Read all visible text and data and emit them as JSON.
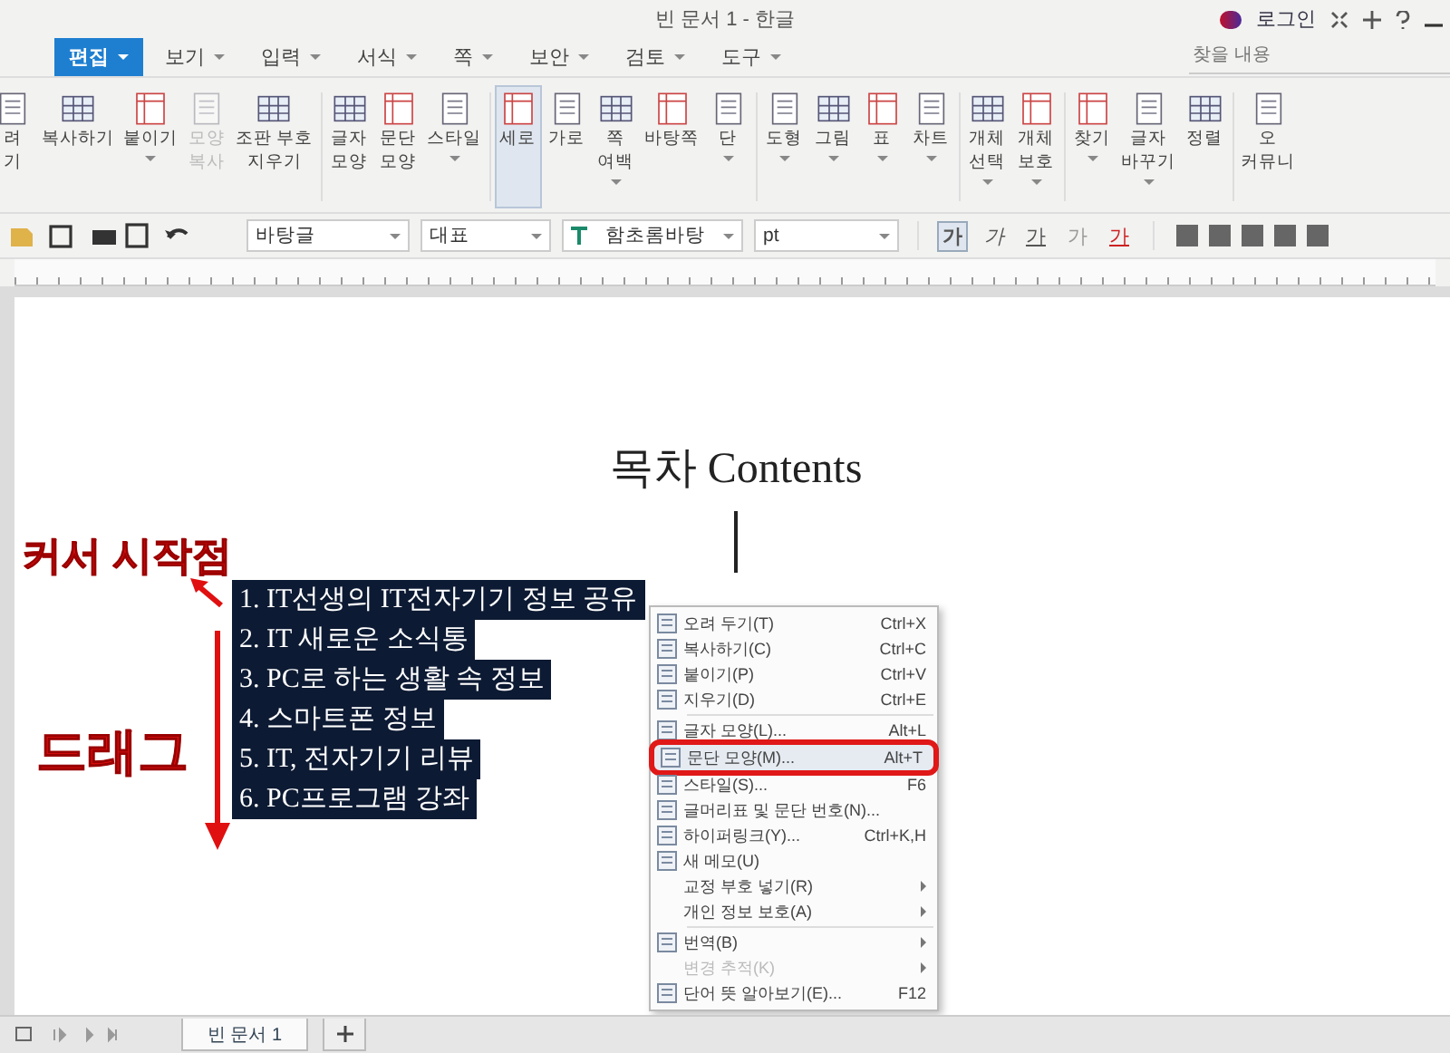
{
  "window": {
    "title": "빈 문서 1 - 한글",
    "login": "로그인"
  },
  "menu": [
    {
      "label": "편집",
      "selected": true
    },
    {
      "label": "보기",
      "selected": false
    },
    {
      "label": "입력",
      "selected": false
    },
    {
      "label": "서식",
      "selected": false
    },
    {
      "label": "쪽",
      "selected": false
    },
    {
      "label": "보안",
      "selected": false
    },
    {
      "label": "검토",
      "selected": false
    },
    {
      "label": "도구",
      "selected": false
    }
  ],
  "search": {
    "placeholder": "찾을 내용"
  },
  "ribbon": [
    [
      {
        "lines": [
          "려",
          "기"
        ],
        "dropdown": false,
        "disabled": false,
        "selected": false
      },
      {
        "lines": [
          "복사하기"
        ],
        "dropdown": false,
        "disabled": false,
        "selected": false
      },
      {
        "lines": [
          "붙이기"
        ],
        "dropdown": true,
        "disabled": false,
        "selected": false
      },
      {
        "lines": [
          "모양",
          "복사"
        ],
        "dropdown": false,
        "disabled": true,
        "selected": false
      },
      {
        "lines": [
          "조판 부호",
          "지우기"
        ],
        "dropdown": false,
        "disabled": false,
        "selected": false
      }
    ],
    [
      {
        "lines": [
          "글자",
          "모양"
        ],
        "dropdown": false,
        "disabled": false,
        "selected": false
      },
      {
        "lines": [
          "문단",
          "모양"
        ],
        "dropdown": false,
        "disabled": false,
        "selected": false
      },
      {
        "lines": [
          "스타일"
        ],
        "dropdown": true,
        "disabled": false,
        "selected": false
      }
    ],
    [
      {
        "lines": [
          "세로"
        ],
        "dropdown": false,
        "disabled": false,
        "selected": true
      },
      {
        "lines": [
          "가로"
        ],
        "dropdown": false,
        "disabled": false,
        "selected": false
      },
      {
        "lines": [
          "쪽",
          "여백"
        ],
        "dropdown": true,
        "disabled": false,
        "selected": false
      },
      {
        "lines": [
          "바탕쪽"
        ],
        "dropdown": false,
        "disabled": false,
        "selected": false
      },
      {
        "lines": [
          "단"
        ],
        "dropdown": true,
        "disabled": false,
        "selected": false
      }
    ],
    [
      {
        "lines": [
          "도형"
        ],
        "dropdown": true,
        "disabled": false,
        "selected": false
      },
      {
        "lines": [
          "그림"
        ],
        "dropdown": true,
        "disabled": false,
        "selected": false
      },
      {
        "lines": [
          "표"
        ],
        "dropdown": true,
        "disabled": false,
        "selected": false
      },
      {
        "lines": [
          "차트"
        ],
        "dropdown": true,
        "disabled": false,
        "selected": false
      }
    ],
    [
      {
        "lines": [
          "개체",
          "선택"
        ],
        "dropdown": true,
        "disabled": false,
        "selected": false
      },
      {
        "lines": [
          "개체",
          "보호"
        ],
        "dropdown": true,
        "disabled": false,
        "selected": false
      }
    ],
    [
      {
        "lines": [
          "찾기"
        ],
        "dropdown": true,
        "disabled": false,
        "selected": false
      },
      {
        "lines": [
          "글자",
          "바꾸기"
        ],
        "dropdown": true,
        "disabled": false,
        "selected": false
      },
      {
        "lines": [
          "정렬"
        ],
        "dropdown": false,
        "disabled": false,
        "selected": false
      }
    ],
    [
      {
        "lines": [
          "오",
          "커뮤니"
        ],
        "dropdown": false,
        "disabled": false,
        "selected": false
      }
    ]
  ],
  "format": {
    "style": "바탕글",
    "language": "대표",
    "font": "함초롬바탕",
    "size_unit": "pt",
    "char_buttons": [
      {
        "label": "가",
        "kind": "bold",
        "selected": true
      },
      {
        "label": "가",
        "kind": "italic",
        "selected": false
      },
      {
        "label": "가",
        "kind": "underline",
        "selected": false
      },
      {
        "label": "가",
        "kind": "outline",
        "selected": false
      },
      {
        "label": "가",
        "kind": "color",
        "selected": false
      }
    ]
  },
  "document": {
    "title": "목차 Contents",
    "list": [
      {
        "text": "1. IT선생의 IT전자기기 정보 공유",
        "selected": true
      },
      {
        "text": "2. IT 새로운 소식통",
        "selected": true
      },
      {
        "text": "3. PC로 하는 생활 속 정보",
        "selected": true
      },
      {
        "text": "4. 스마트폰 정보",
        "selected": true
      },
      {
        "text": "5. IT, 전자기기 리뷰",
        "selected": true
      },
      {
        "text": "6. PC프로그램 강좌",
        "selected": true
      }
    ]
  },
  "annotations": {
    "start": "커서 시작점",
    "drag": "드래그"
  },
  "context_menu": [
    [
      {
        "label": "오려 두기(T)",
        "shortcut": "Ctrl+X",
        "disabled": false,
        "selected": false,
        "submenu": false
      },
      {
        "label": "복사하기(C)",
        "shortcut": "Ctrl+C",
        "disabled": false,
        "selected": false,
        "submenu": false
      },
      {
        "label": "붙이기(P)",
        "shortcut": "Ctrl+V",
        "disabled": false,
        "selected": false,
        "submenu": false
      },
      {
        "label": "지우기(D)",
        "shortcut": "Ctrl+E",
        "disabled": false,
        "selected": false,
        "submenu": false
      }
    ],
    [
      {
        "label": "글자 모양(L)...",
        "shortcut": "Alt+L",
        "disabled": false,
        "selected": false,
        "submenu": false
      },
      {
        "label": "문단 모양(M)...",
        "shortcut": "Alt+T",
        "disabled": false,
        "selected": true,
        "submenu": false
      },
      {
        "label": "스타일(S)...",
        "shortcut": "F6",
        "disabled": false,
        "selected": false,
        "submenu": false
      },
      {
        "label": "글머리표 및 문단 번호(N)...",
        "disabled": false,
        "selected": false,
        "submenu": false
      },
      {
        "label": "하이퍼링크(Y)...",
        "shortcut": "Ctrl+K,H",
        "disabled": false,
        "selected": false,
        "submenu": false
      },
      {
        "label": "새 메모(U)",
        "disabled": false,
        "selected": false,
        "submenu": false
      },
      {
        "label": "교정 부호 넣기(R)",
        "disabled": false,
        "selected": false,
        "submenu": true
      },
      {
        "label": "개인 정보 보호(A)",
        "disabled": false,
        "selected": false,
        "submenu": true
      }
    ],
    [
      {
        "label": "번역(B)",
        "disabled": false,
        "selected": false,
        "submenu": true
      },
      {
        "label": "변경 추적(K)",
        "disabled": true,
        "selected": false,
        "submenu": true
      },
      {
        "label": "단어 뜻 알아보기(E)...",
        "shortcut": "F12",
        "disabled": false,
        "selected": false,
        "submenu": false
      }
    ]
  ],
  "tabs": [
    {
      "label": "빈 문서 1",
      "selected": true
    }
  ]
}
